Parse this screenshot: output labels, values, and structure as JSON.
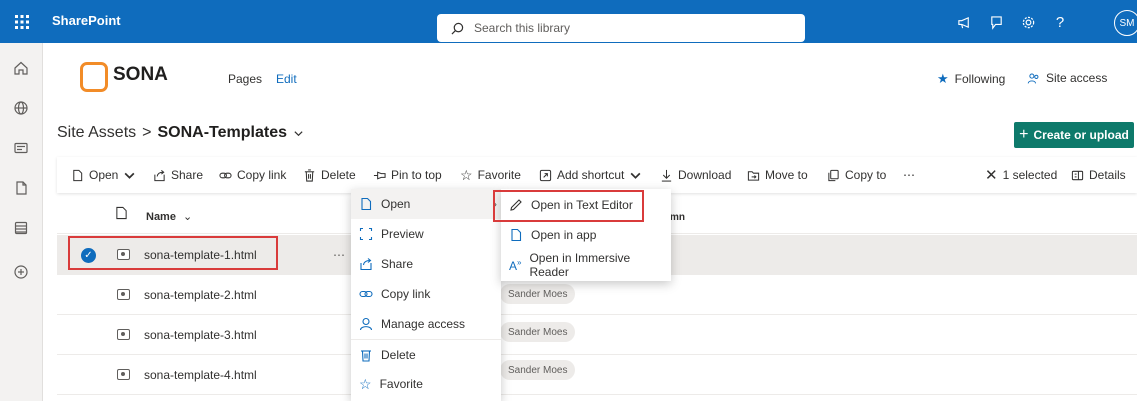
{
  "suite": {
    "app_name": "SharePoint",
    "search_placeholder": "Search this library",
    "avatar_initials": "SM"
  },
  "site": {
    "logo_text": "SONA",
    "nav": [
      "Pages",
      "Edit"
    ],
    "following_label": "Following",
    "site_access_label": "Site access"
  },
  "breadcrumb": {
    "parent": "Site Assets",
    "separator": ">",
    "current": "SONA-Templates"
  },
  "create_button": "Create or upload",
  "commands": {
    "open": "Open",
    "share": "Share",
    "copy_link": "Copy link",
    "delete": "Delete",
    "pin": "Pin to top",
    "favorite": "Favorite",
    "add_shortcut": "Add shortcut",
    "download": "Download",
    "move_to": "Move to",
    "copy_to": "Copy to",
    "more": "⋯",
    "selected": "1 selected",
    "details": "Details"
  },
  "list": {
    "name_header": "Name",
    "column_header_partial": "mn",
    "files": [
      {
        "name": "sona-template-1.html",
        "person": ""
      },
      {
        "name": "sona-template-2.html",
        "person": "Sander Moes"
      },
      {
        "name": "sona-template-3.html",
        "person": "Sander Moes"
      },
      {
        "name": "sona-template-4.html",
        "person": "Sander Moes"
      }
    ]
  },
  "context_menu": {
    "items": [
      "Open",
      "Preview",
      "Share",
      "Copy link",
      "Manage access",
      "Delete",
      "Favorite"
    ]
  },
  "open_submenu": {
    "items": [
      "Open in Text Editor",
      "Open in app",
      "Open in Immersive Reader"
    ]
  },
  "colors": {
    "suite_blue": "#0f6cbd",
    "create_green": "#0e7a6b",
    "highlight_red": "#d93b3b",
    "logo_orange": "#f28c28"
  }
}
